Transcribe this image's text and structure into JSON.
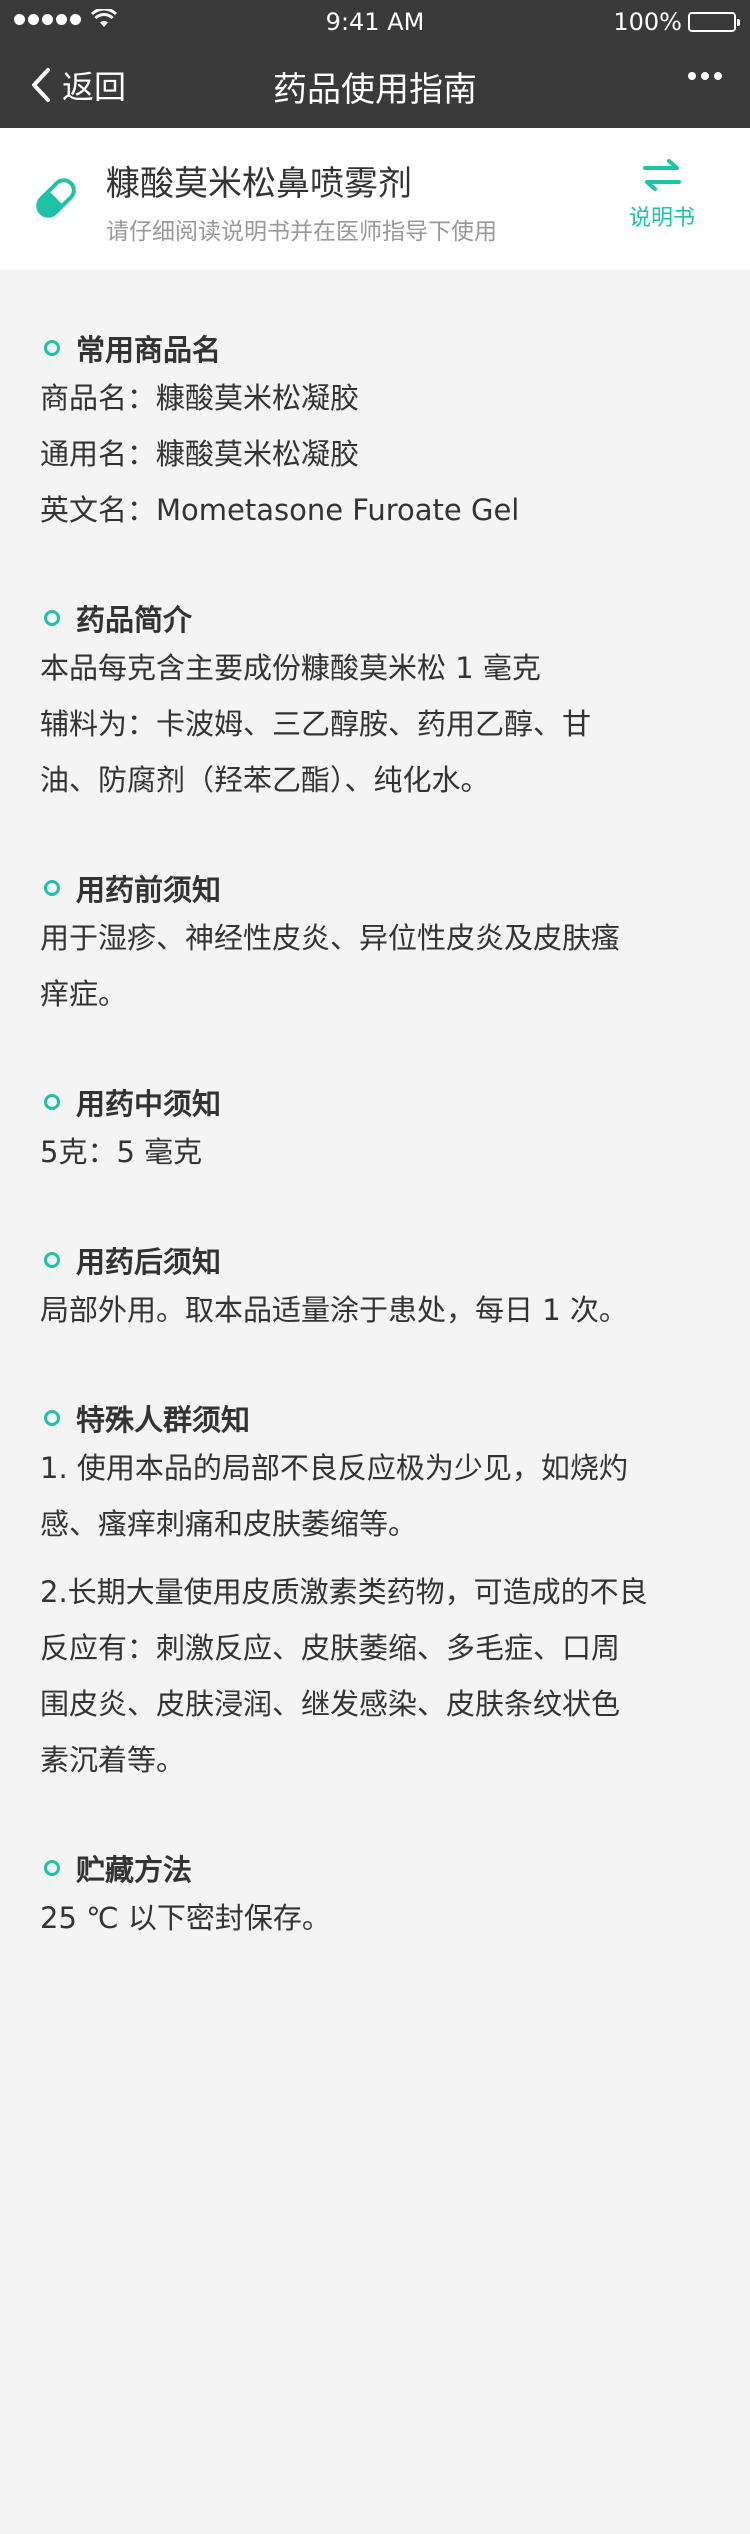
{
  "status_bar": {
    "time": "9:41 AM",
    "battery": "100%"
  },
  "nav": {
    "back_label": "返回",
    "title": "药品使用指南"
  },
  "drug": {
    "name": "糠酸莫米松鼻喷雾剂",
    "tip": "请仔细阅读说明书并在医师指导下使用",
    "manual_label": "说明书"
  },
  "sections": [
    {
      "title": "常用商品名",
      "lines": [
        "商品名：糠酸莫米松凝胶",
        "通用名：糠酸莫米松凝胶",
        "英文名：Mometasone Furoate Gel"
      ]
    },
    {
      "title": "药品简介",
      "lines": [
        "本品每克含主要成份糠酸莫米松 1 毫克",
        "辅料为：卡波姆、三乙醇胺、药用乙醇、甘",
        "油、防腐剂（羟苯乙酯）、纯化水。"
      ]
    },
    {
      "title": "用药前须知",
      "lines": [
        "用于湿疹、神经性皮炎、异位性皮炎及皮肤瘙",
        "痒症。"
      ]
    },
    {
      "title": "用药中须知",
      "lines": [
        "5克：5 毫克"
      ]
    },
    {
      "title": "用药后须知",
      "lines": [
        "局部外用。取本品适量涂于患处，每日 1 次。"
      ]
    },
    {
      "title": "特殊人群须知",
      "lines": [
        "1. 使用本品的局部不良反应极为少见，如烧灼",
        "感、瘙痒刺痛和皮肤萎缩等。",
        "2.长期大量使用皮质激素类药物，可造成的不良",
        "反应有：刺激反应、皮肤萎缩、多毛症、口周",
        "围皮炎、皮肤浸润、继发感染、皮肤条纹状色",
        "素沉着等。"
      ]
    },
    {
      "title": "贮藏方法",
      "lines": [
        "25 ℃ 以下密封保存。"
      ]
    }
  ],
  "colors": {
    "accent": "#1fc2a7",
    "header_bg": "#3a3a3a",
    "page_bg": "#f4f4f4"
  }
}
